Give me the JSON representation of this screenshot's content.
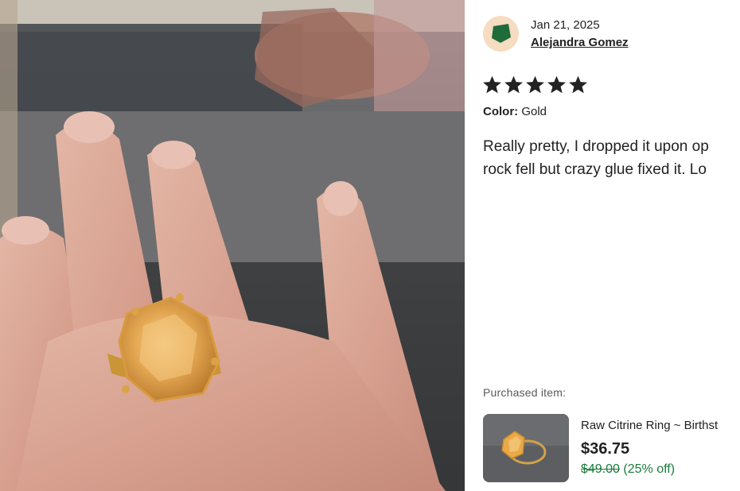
{
  "photo": {
    "alt_icon": "review-photo-hand-with-ring"
  },
  "review": {
    "date": "Jan 21, 2025",
    "reviewer": "Alejandra Gomez",
    "rating": 5,
    "rating_max": 5,
    "color_label": "Color:",
    "color_value": "Gold",
    "text_line1": "Really pretty, I dropped it upon op",
    "text_line2": "rock fell but crazy glue fixed it. Lo"
  },
  "purchased": {
    "label": "Purchased item:",
    "title": "Raw Citrine Ring ~ Birthst",
    "price": "$36.75",
    "original_price": "$49.00",
    "discount": "(25% off)"
  },
  "colors": {
    "avatar_bg": "#f6dcc0",
    "avatar_shape": "#1f6b3a",
    "discount_green": "#1a7a3a",
    "star": "#222222"
  }
}
